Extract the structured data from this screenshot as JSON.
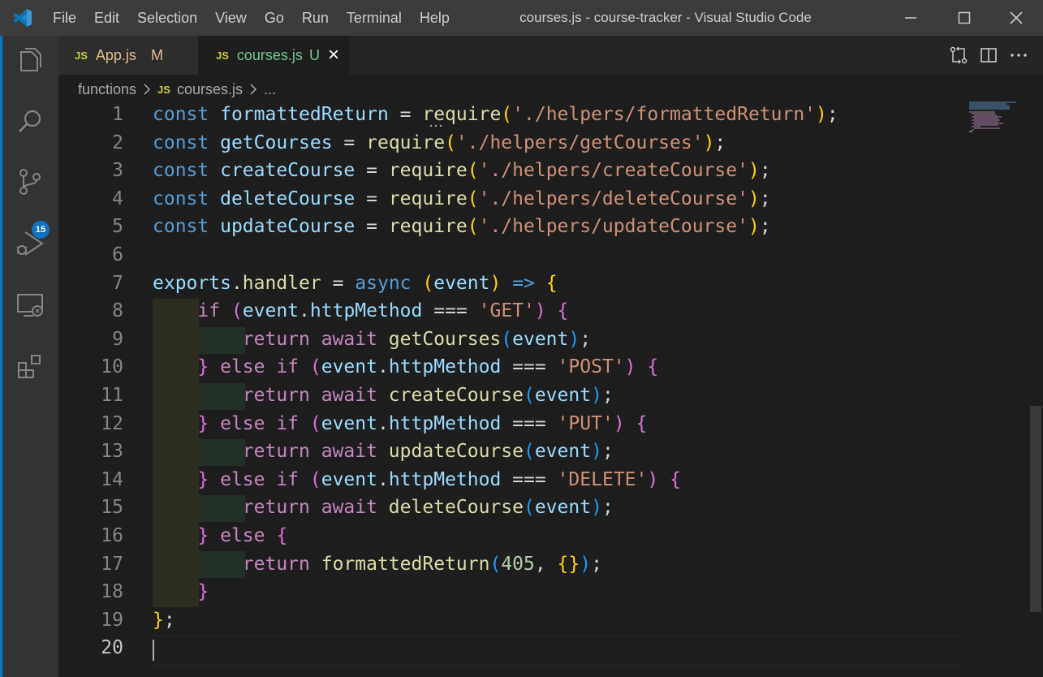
{
  "window": {
    "title": "courses.js - course-tracker - Visual Studio Code"
  },
  "menu": [
    "File",
    "Edit",
    "Selection",
    "View",
    "Go",
    "Run",
    "Terminal",
    "Help"
  ],
  "activity": {
    "scm_badge": "15"
  },
  "tabs": [
    {
      "icon": "JS",
      "label": "App.js",
      "status": "M"
    },
    {
      "icon": "JS",
      "label": "courses.js",
      "status": "U",
      "close": "×"
    }
  ],
  "breadcrumb": {
    "folder": "functions",
    "file_icon": "JS",
    "file": "courses.js",
    "more": "..."
  },
  "editor": {
    "line_numbers": [
      "1",
      "2",
      "3",
      "4",
      "5",
      "6",
      "7",
      "8",
      "9",
      "10",
      "11",
      "12",
      "13",
      "14",
      "15",
      "16",
      "17",
      "18",
      "19",
      "20"
    ],
    "active_line": "20",
    "lines": [
      [
        [
          "k",
          "const "
        ],
        [
          "v",
          "formattedReturn"
        ],
        [
          "p",
          " = "
        ],
        [
          "f",
          "require"
        ],
        [
          "y",
          "("
        ],
        [
          "s",
          "'./helpers/formattedReturn'"
        ],
        [
          "y",
          ")"
        ],
        [
          "p",
          ";"
        ]
      ],
      [
        [
          "k",
          "const "
        ],
        [
          "v",
          "getCourses"
        ],
        [
          "p",
          " = "
        ],
        [
          "f",
          "require"
        ],
        [
          "y",
          "("
        ],
        [
          "s",
          "'./helpers/getCourses'"
        ],
        [
          "y",
          ")"
        ],
        [
          "p",
          ";"
        ]
      ],
      [
        [
          "k",
          "const "
        ],
        [
          "v",
          "createCourse"
        ],
        [
          "p",
          " = "
        ],
        [
          "f",
          "require"
        ],
        [
          "y",
          "("
        ],
        [
          "s",
          "'./helpers/createCourse'"
        ],
        [
          "y",
          ")"
        ],
        [
          "p",
          ";"
        ]
      ],
      [
        [
          "k",
          "const "
        ],
        [
          "v",
          "deleteCourse"
        ],
        [
          "p",
          " = "
        ],
        [
          "f",
          "require"
        ],
        [
          "y",
          "("
        ],
        [
          "s",
          "'./helpers/deleteCourse'"
        ],
        [
          "y",
          ")"
        ],
        [
          "p",
          ";"
        ]
      ],
      [
        [
          "k",
          "const "
        ],
        [
          "v",
          "updateCourse"
        ],
        [
          "p",
          " = "
        ],
        [
          "f",
          "require"
        ],
        [
          "y",
          "("
        ],
        [
          "s",
          "'./helpers/updateCourse'"
        ],
        [
          "y",
          ")"
        ],
        [
          "p",
          ";"
        ]
      ],
      [],
      [
        [
          "v",
          "exports"
        ],
        [
          "p",
          "."
        ],
        [
          "f",
          "handler"
        ],
        [
          "p",
          " = "
        ],
        [
          "k",
          "async "
        ],
        [
          "y",
          "("
        ],
        [
          "v",
          "event"
        ],
        [
          "y",
          ")"
        ],
        [
          "p",
          " "
        ],
        [
          "k",
          "=>"
        ],
        [
          "p",
          " "
        ],
        [
          "y",
          "{"
        ]
      ],
      [
        [
          "p",
          "    "
        ],
        [
          "c",
          "if "
        ],
        [
          "m",
          "("
        ],
        [
          "v",
          "event"
        ],
        [
          "p",
          "."
        ],
        [
          "v",
          "httpMethod"
        ],
        [
          "p",
          " === "
        ],
        [
          "s",
          "'GET'"
        ],
        [
          "m",
          ")"
        ],
        [
          "p",
          " "
        ],
        [
          "m",
          "{"
        ]
      ],
      [
        [
          "p",
          "        "
        ],
        [
          "c",
          "return await "
        ],
        [
          "f",
          "getCourses"
        ],
        [
          "b",
          "("
        ],
        [
          "v",
          "event"
        ],
        [
          "b",
          ")"
        ],
        [
          "p",
          ";"
        ]
      ],
      [
        [
          "p",
          "    "
        ],
        [
          "m",
          "}"
        ],
        [
          "c",
          " else if "
        ],
        [
          "m",
          "("
        ],
        [
          "v",
          "event"
        ],
        [
          "p",
          "."
        ],
        [
          "v",
          "httpMethod"
        ],
        [
          "p",
          " === "
        ],
        [
          "s",
          "'POST'"
        ],
        [
          "m",
          ")"
        ],
        [
          "p",
          " "
        ],
        [
          "m",
          "{"
        ]
      ],
      [
        [
          "p",
          "        "
        ],
        [
          "c",
          "return await "
        ],
        [
          "f",
          "createCourse"
        ],
        [
          "b",
          "("
        ],
        [
          "v",
          "event"
        ],
        [
          "b",
          ")"
        ],
        [
          "p",
          ";"
        ]
      ],
      [
        [
          "p",
          "    "
        ],
        [
          "m",
          "}"
        ],
        [
          "c",
          " else if "
        ],
        [
          "m",
          "("
        ],
        [
          "v",
          "event"
        ],
        [
          "p",
          "."
        ],
        [
          "v",
          "httpMethod"
        ],
        [
          "p",
          " === "
        ],
        [
          "s",
          "'PUT'"
        ],
        [
          "m",
          ")"
        ],
        [
          "p",
          " "
        ],
        [
          "m",
          "{"
        ]
      ],
      [
        [
          "p",
          "        "
        ],
        [
          "c",
          "return await "
        ],
        [
          "f",
          "updateCourse"
        ],
        [
          "b",
          "("
        ],
        [
          "v",
          "event"
        ],
        [
          "b",
          ")"
        ],
        [
          "p",
          ";"
        ]
      ],
      [
        [
          "p",
          "    "
        ],
        [
          "m",
          "}"
        ],
        [
          "c",
          " else if "
        ],
        [
          "m",
          "("
        ],
        [
          "v",
          "event"
        ],
        [
          "p",
          "."
        ],
        [
          "v",
          "httpMethod"
        ],
        [
          "p",
          " === "
        ],
        [
          "s",
          "'DELETE'"
        ],
        [
          "m",
          ")"
        ],
        [
          "p",
          " "
        ],
        [
          "m",
          "{"
        ]
      ],
      [
        [
          "p",
          "        "
        ],
        [
          "c",
          "return await "
        ],
        [
          "f",
          "deleteCourse"
        ],
        [
          "b",
          "("
        ],
        [
          "v",
          "event"
        ],
        [
          "b",
          ")"
        ],
        [
          "p",
          ";"
        ]
      ],
      [
        [
          "p",
          "    "
        ],
        [
          "m",
          "}"
        ],
        [
          "c",
          " else "
        ],
        [
          "m",
          "{"
        ]
      ],
      [
        [
          "p",
          "        "
        ],
        [
          "c",
          "return "
        ],
        [
          "f",
          "formattedReturn"
        ],
        [
          "b",
          "("
        ],
        [
          "n",
          "405"
        ],
        [
          "p",
          ", "
        ],
        [
          "y",
          "{}"
        ],
        [
          "b",
          ")"
        ],
        [
          "p",
          ";"
        ]
      ],
      [
        [
          "p",
          "    "
        ],
        [
          "m",
          "}"
        ]
      ],
      [
        [
          "y",
          "}"
        ],
        [
          "p",
          ";"
        ]
      ],
      []
    ]
  },
  "icons": {
    "app": "vscode-logo-icon",
    "activity": [
      "explorer-icon",
      "search-icon",
      "source-control-icon",
      "run-debug-icon",
      "remote-explorer-icon",
      "extensions-icon"
    ],
    "tab_actions": [
      "compare-changes-icon",
      "split-editor-icon",
      "more-actions-icon"
    ],
    "window": [
      "minimize-icon",
      "maximize-icon",
      "close-window-icon"
    ]
  },
  "colors": {
    "accent": "#007acc",
    "badge": "#0e70c0",
    "js_icon": "#cbcb41"
  }
}
